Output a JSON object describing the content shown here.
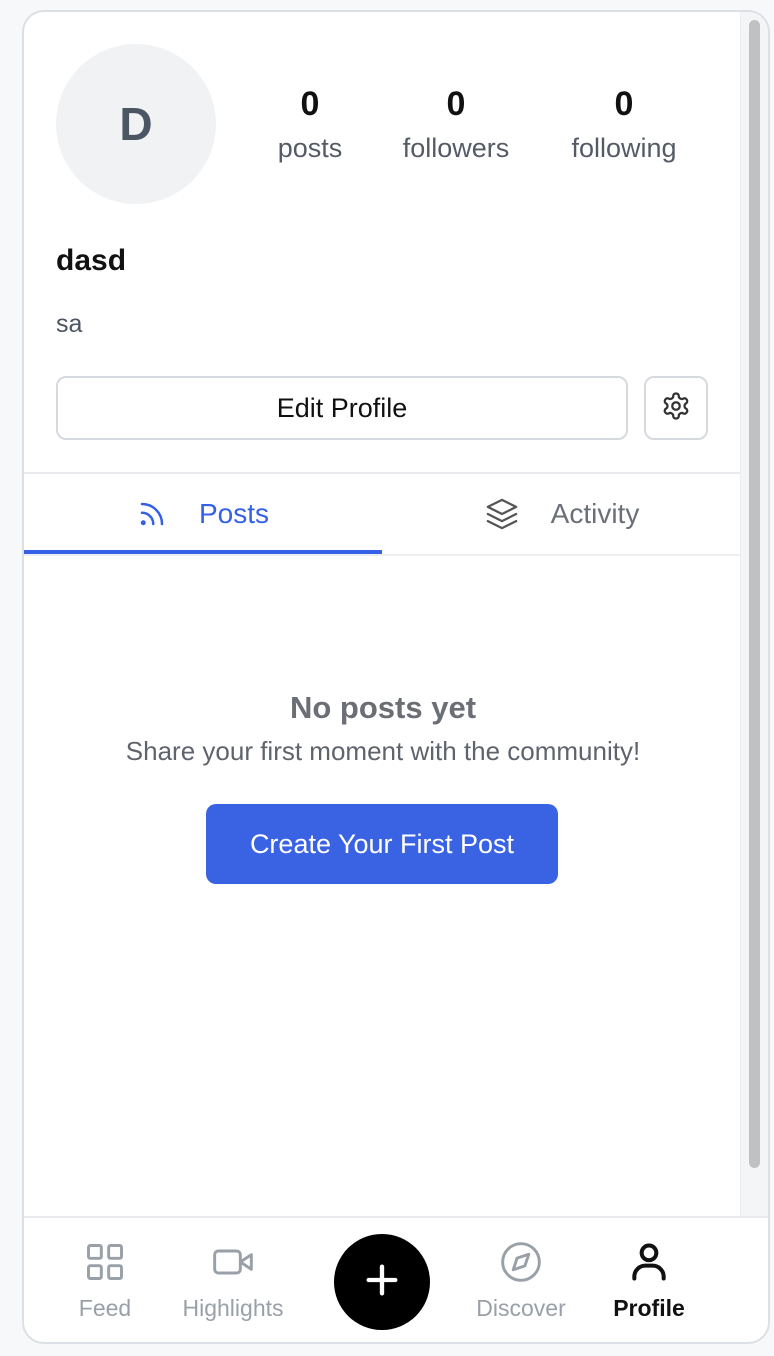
{
  "profile": {
    "avatar_initial": "D",
    "username": "dasd",
    "bio": "sa",
    "stats": {
      "posts_count": "0",
      "posts_label": "posts",
      "followers_count": "0",
      "followers_label": "followers",
      "following_count": "0",
      "following_label": "following"
    },
    "edit_button_label": "Edit Profile"
  },
  "tabs": [
    {
      "label": "Posts",
      "icon": "rss-icon",
      "active": true
    },
    {
      "label": "Activity",
      "icon": "layers-icon",
      "active": false
    }
  ],
  "empty_state": {
    "title": "No posts yet",
    "subtitle": "Share your first moment with the community!",
    "cta_label": "Create Your First Post"
  },
  "bottom_nav": {
    "items": [
      {
        "label": "Feed",
        "icon": "grid-icon"
      },
      {
        "label": "Highlights",
        "icon": "video-icon"
      },
      {
        "label": "",
        "icon": "plus-icon"
      },
      {
        "label": "Discover",
        "icon": "compass-icon"
      },
      {
        "label": "Profile",
        "icon": "user-icon",
        "active": true
      }
    ]
  },
  "colors": {
    "accent": "#3a63e3",
    "tab_active": "#3461e6",
    "nav_inactive": "#9aa0a8",
    "nav_active": "#111111"
  }
}
